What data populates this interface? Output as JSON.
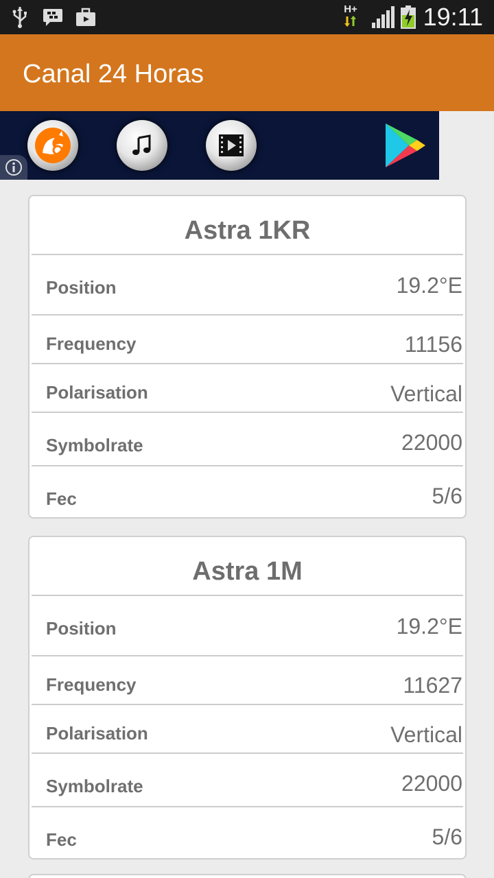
{
  "status_bar": {
    "time": "19:11",
    "network": "H+",
    "icons": [
      "usb-icon",
      "bbm-icon",
      "briefcase-icon",
      "network-arrows-icon",
      "signal-icon",
      "battery-charging-icon"
    ]
  },
  "app_bar": {
    "title": "Canal 24 Horas",
    "color": "#d4761e"
  },
  "ad_banner": {
    "icons": [
      "uc-browser-icon",
      "music-note-icon",
      "film-icon",
      "play-store-icon"
    ],
    "info_icon": "info-icon"
  },
  "cards": [
    {
      "title": "Astra 1KR",
      "rows": [
        {
          "label": "Position",
          "value": "19.2°E"
        },
        {
          "label": "Frequency",
          "value": "11156"
        },
        {
          "label": "Polarisation",
          "value": "Vertical"
        },
        {
          "label": "Symbolrate",
          "value": "22000"
        },
        {
          "label": "Fec",
          "value": "5/6"
        }
      ]
    },
    {
      "title": "Astra 1M",
      "rows": [
        {
          "label": "Position",
          "value": "19.2°E"
        },
        {
          "label": "Frequency",
          "value": "11627"
        },
        {
          "label": "Polarisation",
          "value": "Vertical"
        },
        {
          "label": "Symbolrate",
          "value": "22000"
        },
        {
          "label": "Fec",
          "value": "5/6"
        }
      ]
    }
  ]
}
